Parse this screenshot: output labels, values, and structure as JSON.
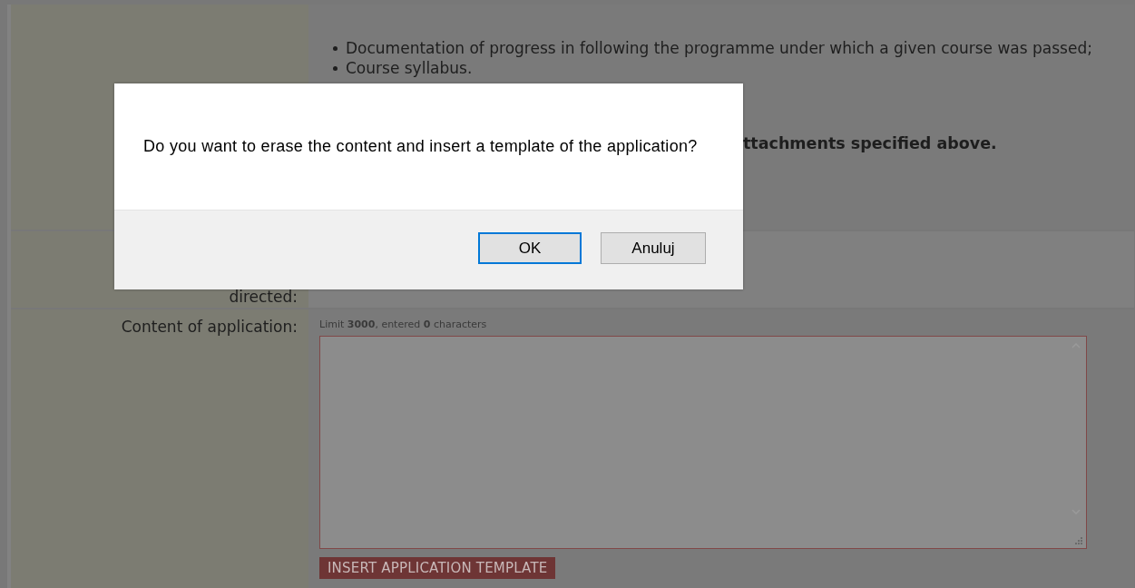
{
  "form": {
    "rows": [
      {
        "label": "",
        "bullets": [
          "Documentation of progress in following the programme under which a given course was passed;",
          "Course syllabus."
        ],
        "note": "ttachments specified above."
      },
      {
        "label": "directed:"
      },
      {
        "label": "Content of application:",
        "hint": "Limit **3000**, entered **0** characters",
        "button": "INSERT APPLICATION TEMPLATE"
      }
    ]
  },
  "dialog": {
    "message": "Do you want to erase the content and insert a template of the application?",
    "buttons": [
      {
        "label": "OK",
        "selected": true
      },
      {
        "label": "Anuluj",
        "selected": false
      }
    ]
  }
}
